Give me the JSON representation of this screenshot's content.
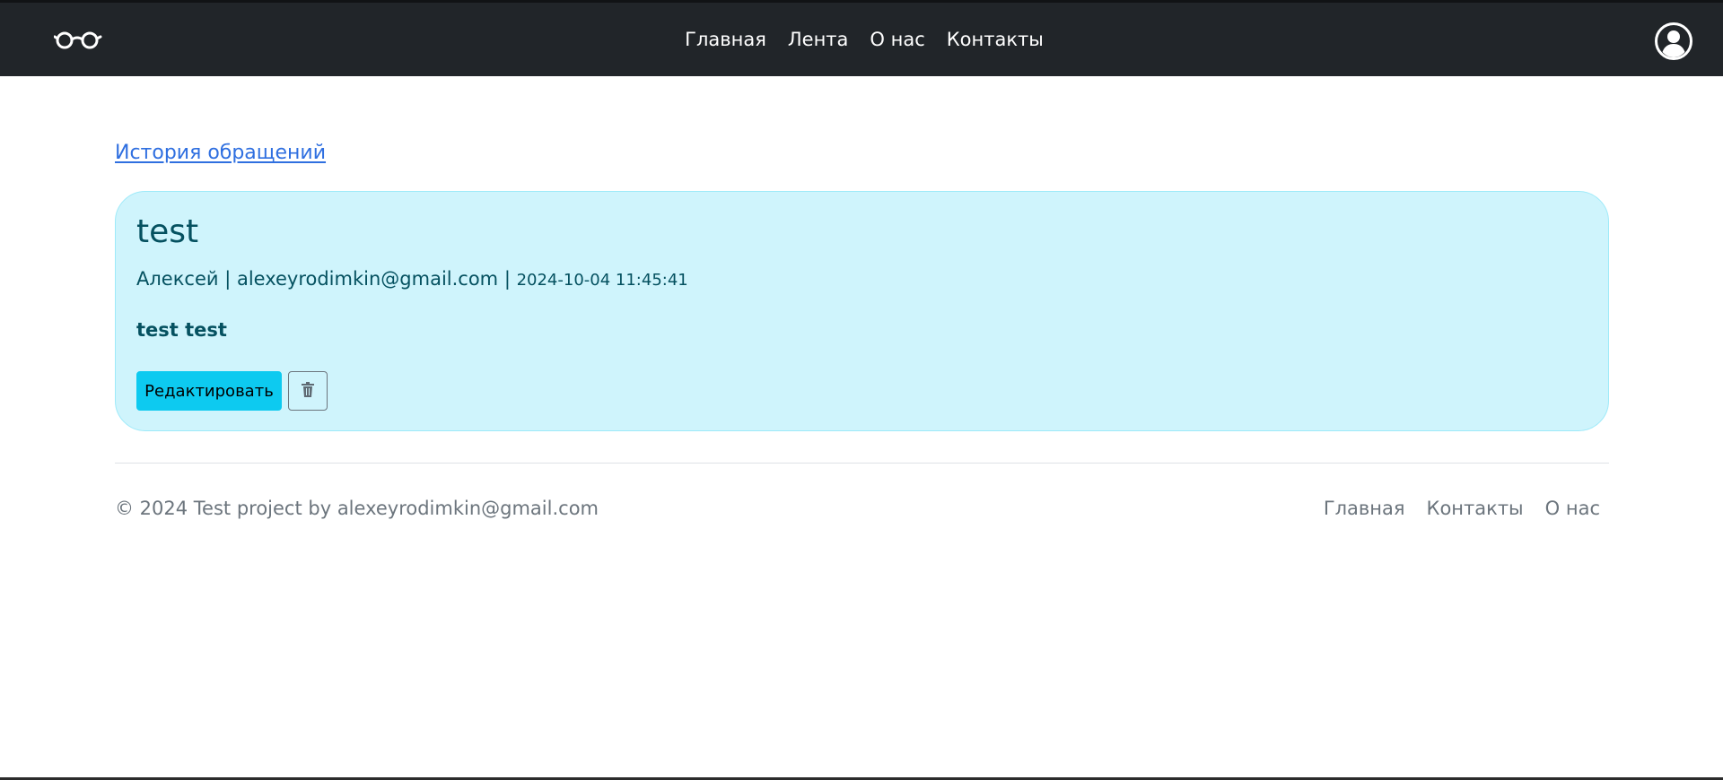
{
  "navbar": {
    "logo_icon": "glasses-icon",
    "links": [
      "Главная",
      "Лента",
      "О нас",
      "Контакты"
    ],
    "avatar_icon": "user-circle-icon"
  },
  "main": {
    "history_link": "История обращений",
    "card": {
      "title": "test",
      "author": "Алексей",
      "separator": " | ",
      "email": "alexeyrodimkin@gmail.com",
      "timestamp": "2024-10-04 11:45:41",
      "body": "test test",
      "edit_label": "Редактировать",
      "delete_icon": "trash-icon"
    }
  },
  "footer": {
    "copyright": "© 2024 Test project by alexeyrodimkin@gmail.com",
    "links": [
      "Главная",
      "Контакты",
      "О нас"
    ]
  },
  "colors": {
    "navbar_bg": "#212529",
    "card_bg": "#cff4fc",
    "card_text": "#055160",
    "accent_button": "#0dcaf0",
    "link": "#2f6fe0"
  }
}
